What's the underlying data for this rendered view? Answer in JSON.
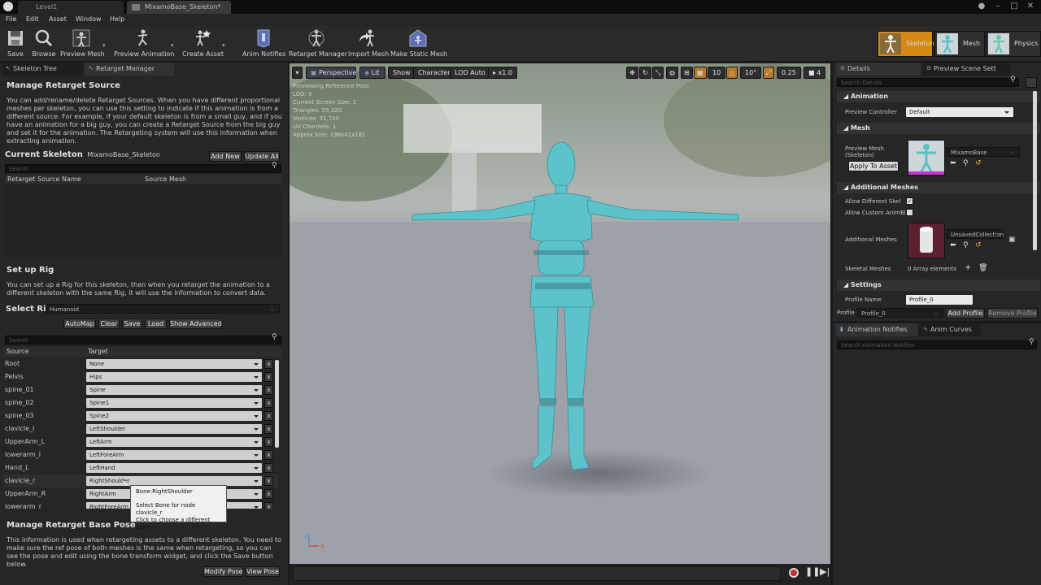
{
  "window": {
    "tabs": [
      {
        "label": "Level1"
      },
      {
        "label": "MixamoBase_Skeleton*"
      }
    ]
  },
  "menu": {
    "items": [
      "File",
      "Edit",
      "Asset",
      "Window",
      "Help"
    ]
  },
  "toolbar": {
    "buttons": [
      {
        "label": "Save",
        "icon": "save-icon"
      },
      {
        "label": "Browse",
        "icon": "browse-icon"
      },
      {
        "label": "Preview Mesh",
        "icon": "preview-mesh-icon"
      },
      {
        "label": "Preview Animation",
        "icon": "preview-animation-icon"
      },
      {
        "label": "Create Asset",
        "icon": "create-asset-icon"
      },
      {
        "label": "Anim Notifies",
        "icon": "anim-notifies-icon"
      },
      {
        "label": "Retarget Manager",
        "icon": "retarget-manager-icon"
      },
      {
        "label": "Import Mesh",
        "icon": "import-mesh-icon"
      },
      {
        "label": "Make Static Mesh",
        "icon": "make-static-mesh-icon"
      }
    ],
    "modes": [
      {
        "label": "Skeleton"
      },
      {
        "label": "Mesh"
      },
      {
        "label": "Physics"
      }
    ]
  },
  "left_panel": {
    "tabs": [
      {
        "label": "Skeleton Tree"
      },
      {
        "label": "Retarget Manager"
      }
    ],
    "retarget_source": {
      "heading": "Manage Retarget Source",
      "description": "You can add/rename/delete Retarget Sources. When you have different proportional meshes per skeleton, you can use this setting to indicate if this animation is from a different source. For example, if your default skeleton is from a small guy, and if you have an animation for a big guy, you can create a Retarget Source from the big guy and set it for the animation. The Retargeting system will use this information when extracting animation.",
      "current_skeleton_label": "Current Skeleton",
      "current_skeleton_value": "MixamoBase_Skeleton",
      "add_new": "Add New",
      "update_all": "Update All",
      "search_placeholder": "Search",
      "col_source_name": "Retarget Source Name",
      "col_source_mesh": "Source Mesh"
    },
    "rig": {
      "heading": "Set up Rig",
      "description": "You can set up a Rig for this skeleton, then when you retarget the animation to a different skeleton with the same Rig, it will use the information to convert data.",
      "select_rig_label": "Select Rig",
      "select_rig_value": "Humanoid",
      "buttons": [
        "AutoMap",
        "Clear",
        "Save",
        "Load",
        "Show Advanced"
      ],
      "search_placeholder": "Search",
      "col_source": "Source",
      "col_target": "Target",
      "rows": [
        {
          "source": "Root",
          "target": "None"
        },
        {
          "source": "Pelvis",
          "target": "Hips"
        },
        {
          "source": "spine_01",
          "target": "Spine"
        },
        {
          "source": "spine_02",
          "target": "Spine1"
        },
        {
          "source": "spine_03",
          "target": "Spine2"
        },
        {
          "source": "clavicle_l",
          "target": "LeftShoulder"
        },
        {
          "source": "UpperArm_L",
          "target": "LeftArm"
        },
        {
          "source": "lowerarm_l",
          "target": "LeftForeArm"
        },
        {
          "source": "Hand_L",
          "target": "LeftHand"
        },
        {
          "source": "clavicle_r",
          "target": "RightShoulder"
        },
        {
          "source": "UpperArm_R",
          "target": "RightArm"
        },
        {
          "source": "lowerarm_r",
          "target": "RightForeArm"
        }
      ],
      "remove_label": "x"
    },
    "tooltip": {
      "title": "Bone:RightShoulder",
      "line1": "Select Bone for node clavicle_r",
      "line2": "Click to choose a different bone"
    },
    "base_pose": {
      "heading": "Manage Retarget Base Pose",
      "description": "This information is used when retargeting assets to a different skeleton. You need to make sure the ref pose of both meshes is the same when retargeting, so you can see the pose and edit using the bone transform widget, and click the Save button below.",
      "modify_pose": "Modify Pose",
      "view_pose": "View Pose"
    }
  },
  "viewport": {
    "perspective": "Perspective",
    "lit": "Lit",
    "show": "Show",
    "character": "Character",
    "lod": "LOD Auto",
    "speed": "x1.0",
    "grid_snap": "10",
    "rot_snap": "10°",
    "scale_snap": "0.25",
    "camera_speed": "4",
    "stats": [
      "Previewing Reference Pose",
      "LOD: 0",
      "Current Screen Size: 1",
      "Triangles: 55,320",
      "Vertices: 31,740",
      "UV Channels: 1",
      "Approx Size: 198x41x181"
    ],
    "axis_z": "Z",
    "axis_x": "X"
  },
  "details": {
    "tabs": [
      {
        "label": "Details"
      },
      {
        "label": "Preview Scene Sett"
      }
    ],
    "search_placeholder": "Search Details",
    "animation_section": "Animation",
    "preview_controller_label": "Preview Controller",
    "preview_controller_value": "Default",
    "mesh_section": "Mesh",
    "preview_mesh_label": "Preview Mesh (Skeleton)",
    "preview_mesh_value": "MixamoBase",
    "apply_to_asset": "Apply To Asset",
    "additional_meshes_section": "Additional Meshes",
    "allow_different_label": "Allow Different Skel",
    "allow_custom_label": "Allow Custom AnimBl",
    "additional_meshes_label": "Additional Meshes",
    "additional_meshes_value": "UnsavedCollection",
    "skeletal_meshes_label": "Skeletal Meshes",
    "skeletal_meshes_value": "0 Array elements",
    "settings_section": "Settings",
    "profile_name_label": "Profile Name",
    "profile_name_value": "Profile_0",
    "profile_label": "Profile",
    "profile_value": "Profile_0",
    "add_profile": "Add Profile",
    "remove_profile": "Remove Profile"
  },
  "bottom_right": {
    "tabs": [
      {
        "label": "Animation Notifies"
      },
      {
        "label": "Anim Curves"
      }
    ],
    "search_placeholder": "Search Animation Notifies"
  }
}
